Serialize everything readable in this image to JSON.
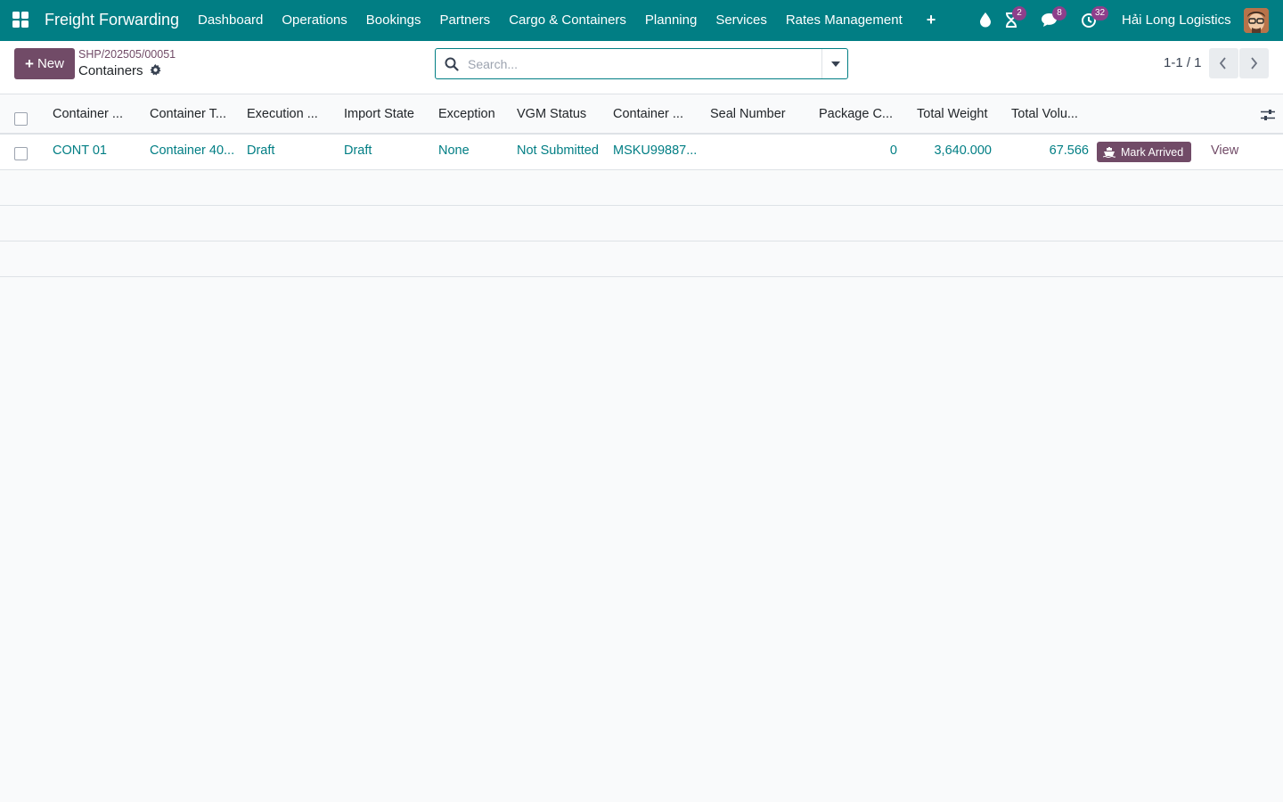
{
  "navbar": {
    "app_name": "Freight Forwarding",
    "menu": [
      "Dashboard",
      "Operations",
      "Bookings",
      "Partners",
      "Cargo & Containers",
      "Planning",
      "Services",
      "Rates Management"
    ],
    "plus": "+",
    "activity_count": "2",
    "messages_count": "8",
    "timer_count": "32",
    "company": "Hải Long Logistics"
  },
  "control_panel": {
    "new_label": "New",
    "breadcrumb_parent": "SHP/202505/00051",
    "breadcrumb_current": "Containers",
    "search_placeholder": "Search...",
    "pager": "1-1 / 1"
  },
  "list": {
    "columns": [
      "Container ...",
      "Container T...",
      "Execution ...",
      "Import State",
      "Exception",
      "VGM Status",
      "Container ...",
      "Seal Number",
      "Package C...",
      "Total Weight",
      "Total Volu..."
    ],
    "rows": [
      {
        "container": "CONT 01",
        "container_type": "Container 40...",
        "execution": "Draft",
        "import_state": "Draft",
        "exception": "None",
        "vgm_status": "Not Submitted",
        "container_no": "MSKU99887...",
        "seal_number": "",
        "package_count": "0",
        "total_weight": "3,640.000",
        "total_volume": "67.566",
        "action_label": "Mark Arrived",
        "view_label": "View"
      }
    ]
  },
  "colors": {
    "navbar": "#017e84",
    "primary": "#714b67",
    "link": "#017e84",
    "badge": "#8e3f8b"
  }
}
